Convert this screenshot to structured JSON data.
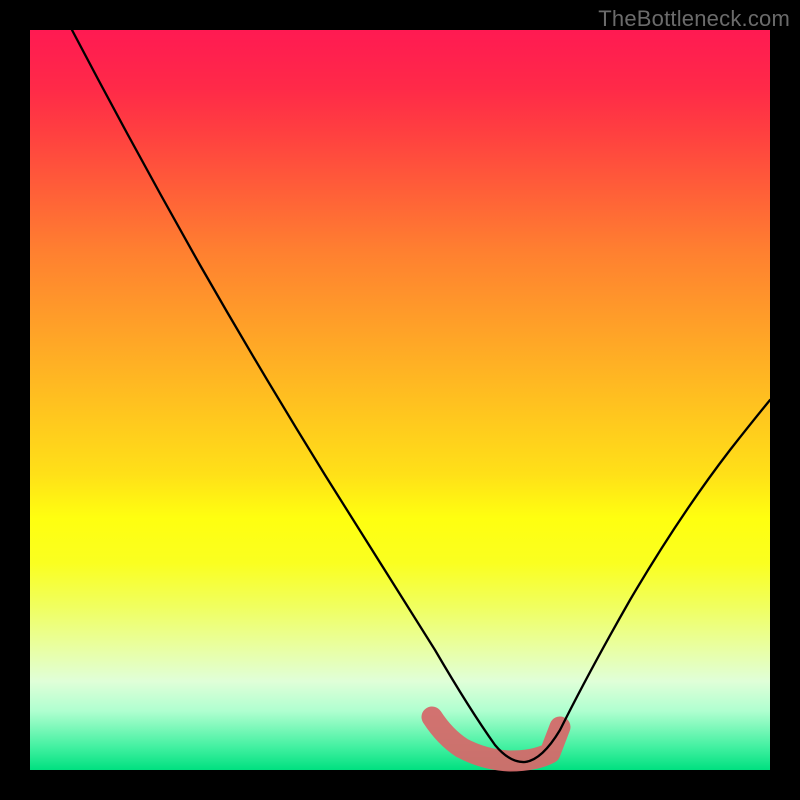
{
  "watermark": "TheBottleneck.com",
  "colors": {
    "gradient_top": "#ff1a52",
    "gradient_bottom": "#00e080",
    "curve": "#000000",
    "highlight": "#d46a6a",
    "frame": "#000000"
  },
  "chart_data": {
    "type": "line",
    "title": "",
    "xlabel": "",
    "ylabel": "",
    "xlim": [
      0,
      100
    ],
    "ylim": [
      0,
      100
    ],
    "grid": false,
    "x": [
      5,
      10,
      15,
      20,
      25,
      30,
      35,
      40,
      45,
      50,
      54,
      58,
      62,
      66,
      70,
      75,
      80,
      85,
      90,
      95,
      100
    ],
    "values": [
      100,
      92,
      84,
      76,
      68,
      60,
      52,
      43,
      34,
      24,
      14,
      7,
      3,
      1,
      2,
      6,
      13,
      22,
      32,
      42,
      52
    ],
    "highlight_range_x": [
      54,
      72
    ],
    "note": "V-shaped curve with flat valley around x≈62–68; salmon highlight marks valley floor. Values estimated from pixel position; no axes/ticks rendered."
  }
}
